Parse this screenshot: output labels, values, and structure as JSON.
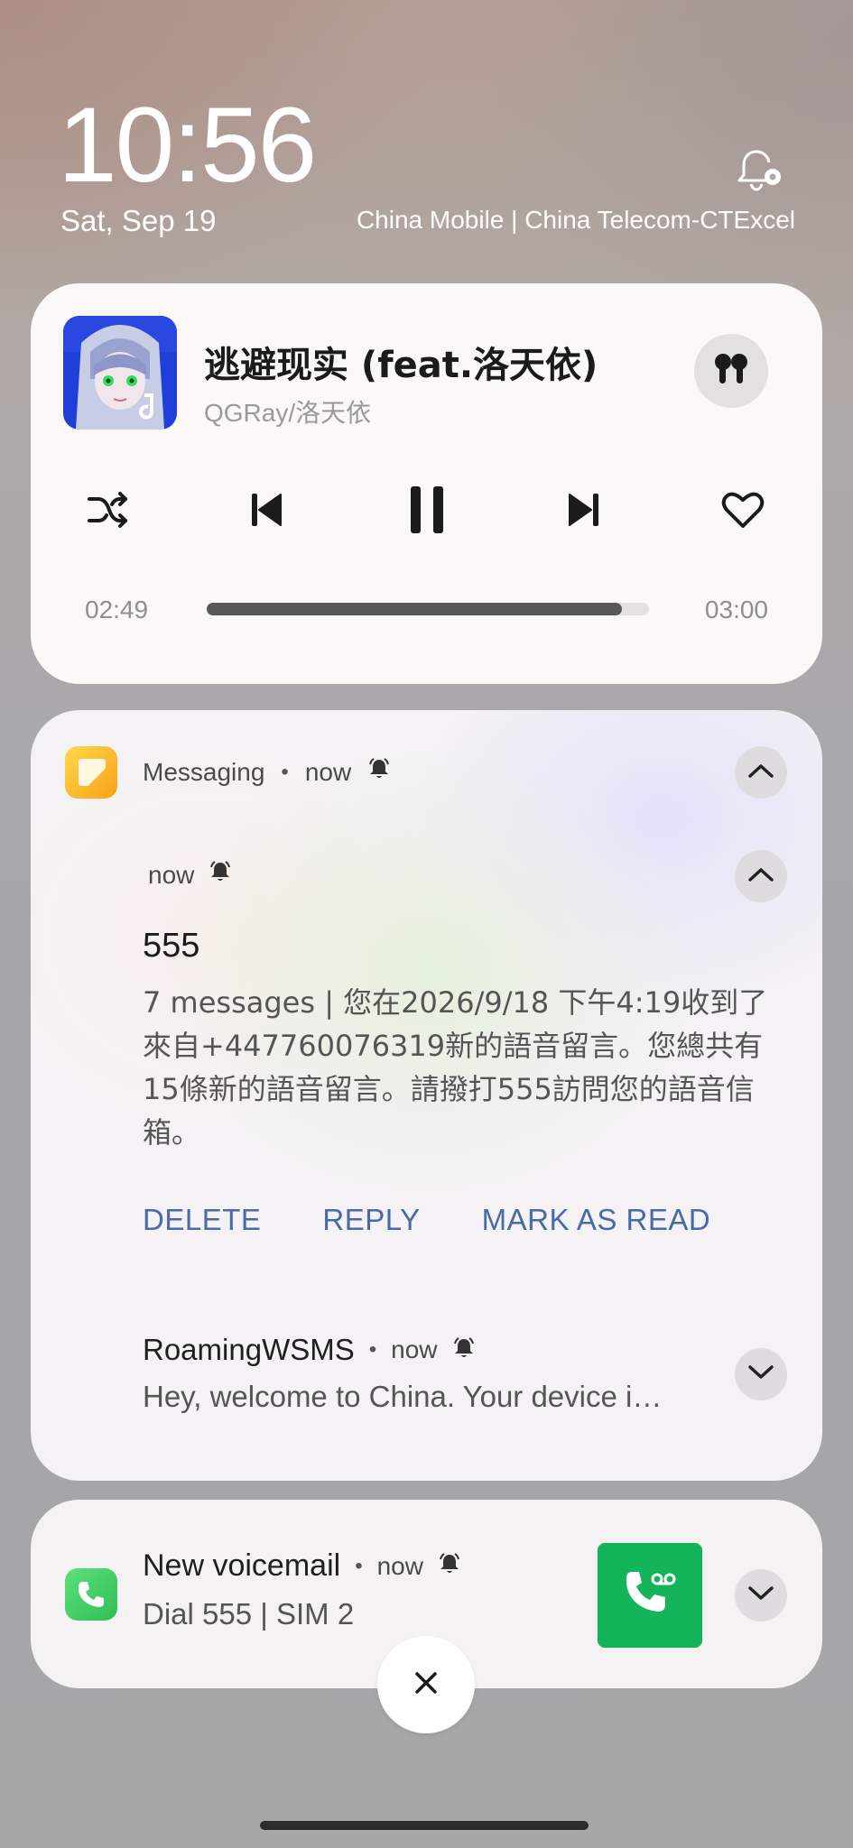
{
  "status": {
    "time": "10:56",
    "date": "Sat, Sep 19",
    "carriers": "China Mobile | China Telecom-CTExcel"
  },
  "media": {
    "title": "逃避现实 (feat.洛天依)",
    "artist": "QGRay/洛天依",
    "elapsed": "02:49",
    "total": "03:00",
    "progress_fraction": 0.939,
    "accent": "#585858",
    "icons": [
      "earbuds-icon",
      "shuffle-icon",
      "previous-icon",
      "pause-icon",
      "next-icon",
      "heart-icon"
    ]
  },
  "messaging": {
    "app_name": "Messaging",
    "time": "now",
    "thread_time": "now",
    "sender": "555",
    "body": "7 messages | 您在2026/9/18 下午4:19收到了來自+447760076319新的語音留言。您總共有15條新的語音留言。請撥打555訪問您的語音信箱。",
    "actions": {
      "delete": "DELETE",
      "reply": "REPLY",
      "mark_read": "MARK AS READ"
    },
    "action_color": "#4a6aa6",
    "roaming": {
      "sender": "RoamingWSMS",
      "time": "now",
      "preview": "Hey, welcome to China. Your device i…"
    }
  },
  "voicemail": {
    "title": "New voicemail",
    "time": "now",
    "subtitle": "Dial 555  |  SIM 2",
    "button_color": "#13b45a"
  }
}
